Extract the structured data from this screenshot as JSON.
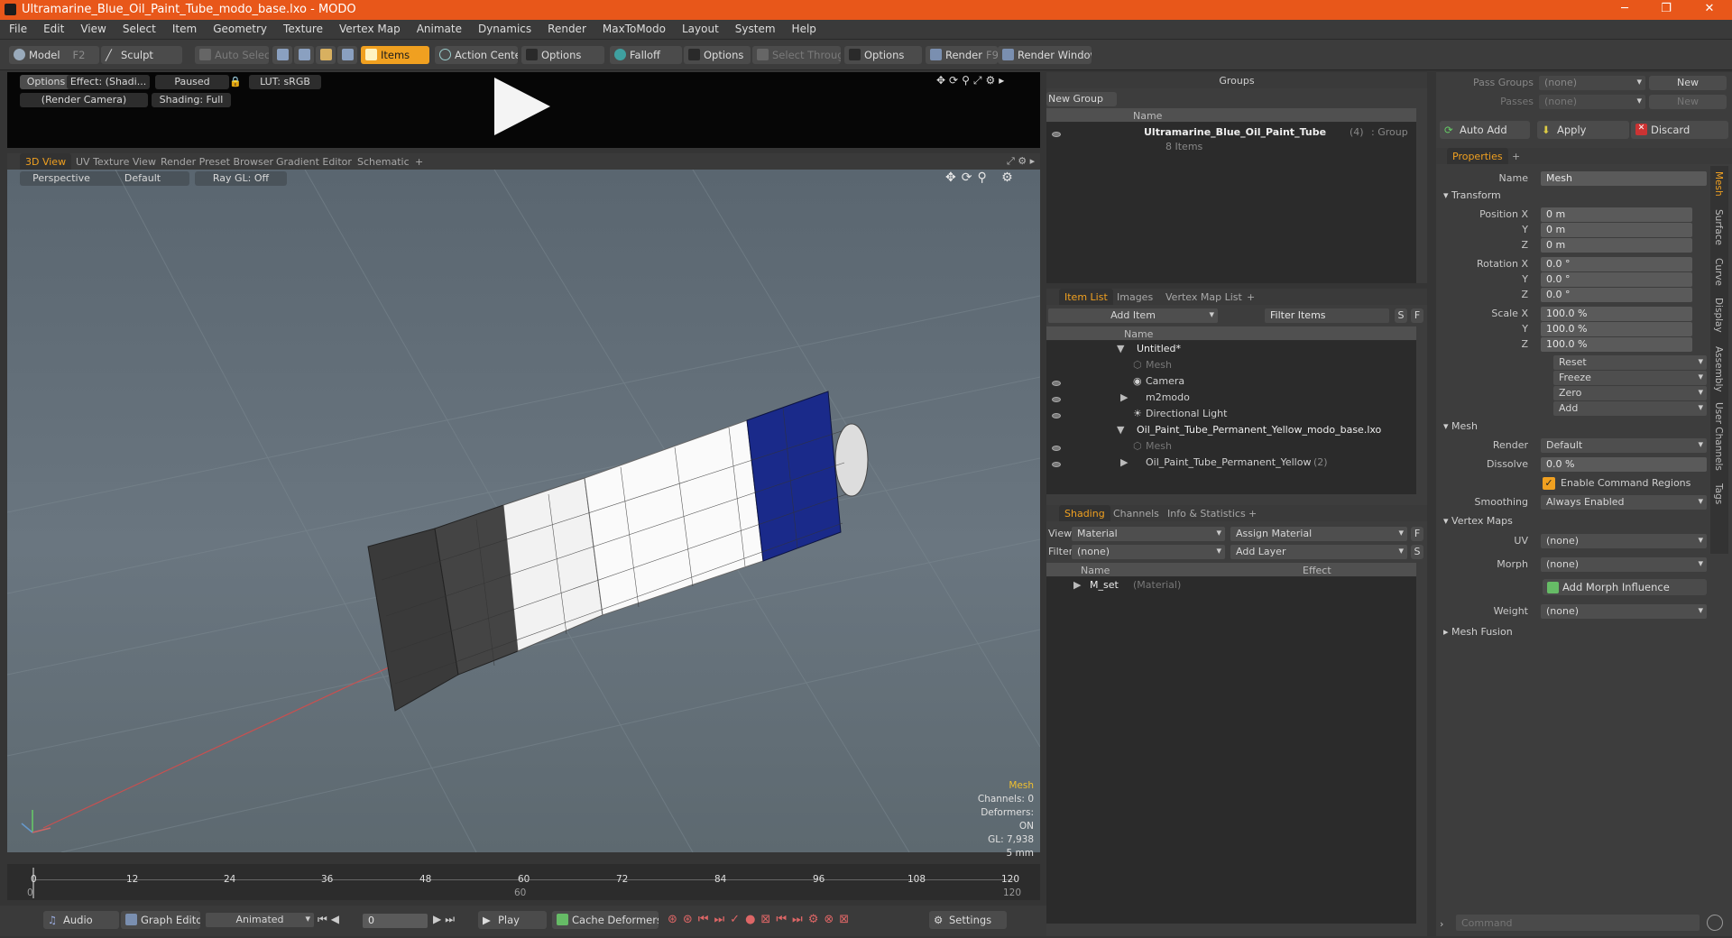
{
  "window": {
    "title": "Ultramarine_Blue_Oil_Paint_Tube_modo_base.lxo - MODO",
    "controls": [
      "─",
      "❐",
      "✕"
    ]
  },
  "menu": [
    "File",
    "Edit",
    "View",
    "Select",
    "Item",
    "Geometry",
    "Texture",
    "Vertex Map",
    "Animate",
    "Dynamics",
    "Render",
    "MaxToModo",
    "Layout",
    "System",
    "Help"
  ],
  "toolbar": {
    "model": "Model",
    "model_key": "F2",
    "sculpt": "Sculpt",
    "auto_select": "Auto Select",
    "items": "Items",
    "action_center": "Action Center",
    "options1": "Options",
    "falloff": "Falloff",
    "options2": "Options",
    "select_through": "Select Through",
    "options3": "Options",
    "render": "Render",
    "render_key": "F9",
    "render_window": "Render Window"
  },
  "preview": {
    "options": "Options",
    "effect": "Effect: (Shadi...",
    "paused": "Paused",
    "lut": "LUT: sRGB",
    "camera": "(Render Camera)",
    "shading": "Shading: Full"
  },
  "view_tabs": [
    "3D View",
    "UV Texture View",
    "Render Preset Browser",
    "Gradient Editor",
    "Schematic",
    "+"
  ],
  "view_bar": {
    "perspective": "Perspective",
    "default": "Default",
    "raygl": "Ray GL: Off"
  },
  "viewport_info": {
    "mesh": "Mesh",
    "channels": "Channels: 0",
    "deformers": "Deformers: ON",
    "gl": "GL: 7,938",
    "scale": "5 mm"
  },
  "timeline": {
    "ticks": [
      "0",
      "12",
      "24",
      "36",
      "48",
      "60",
      "72",
      "84",
      "96",
      "108",
      "120"
    ],
    "sub_ticks": [
      "0",
      "60",
      "120",
      "120"
    ]
  },
  "bottom_bar": {
    "audio": "Audio",
    "graph_editor": "Graph Editor",
    "animated": "Animated",
    "frame": "0",
    "play": "Play",
    "cache_deformers": "Cache Deformers",
    "settings": "Settings"
  },
  "groups": {
    "title": "Groups",
    "new_group": "New Group",
    "name_col": "Name",
    "item_name": "Ultramarine_Blue_Oil_Paint_Tube",
    "item_count": "(4)",
    "item_type": ": Group",
    "item_sub": "8 Items"
  },
  "item_list": {
    "tabs": [
      "Item List",
      "Images",
      "Vertex Map List",
      "+"
    ],
    "add_item": "Add Item",
    "filter_items": "Filter Items",
    "s": "S",
    "f": "F",
    "name_col": "Name",
    "rows": [
      {
        "label": "Untitled*",
        "indent": 0,
        "type": "scene",
        "dim": false
      },
      {
        "label": "Mesh",
        "indent": 1,
        "type": "mesh",
        "dim": true
      },
      {
        "label": "Camera",
        "indent": 1,
        "type": "camera",
        "dim": false
      },
      {
        "label": "m2modo",
        "indent": 1,
        "type": "locator",
        "dim": false
      },
      {
        "label": "Directional Light",
        "indent": 1,
        "type": "light",
        "dim": false
      },
      {
        "label": "Oil_Paint_Tube_Permanent_Yellow_modo_base.lxo",
        "indent": 0,
        "type": "scene",
        "dim": false
      },
      {
        "label": "Mesh",
        "indent": 1,
        "type": "mesh",
        "dim": true
      },
      {
        "label": "Oil_Paint_Tube_Permanent_Yellow",
        "indent": 1,
        "type": "locator",
        "dim": false,
        "suffix": "(2)"
      }
    ]
  },
  "shading": {
    "tabs": [
      "Shading",
      "Channels",
      "Info & Statistics",
      "+"
    ],
    "view_label": "View",
    "view_value": "Material",
    "assign_material": "Assign Material",
    "f": "F",
    "filter_label": "Filter",
    "filter_value": "(none)",
    "add_layer": "Add Layer",
    "s": "S",
    "name_col": "Name",
    "effect_col": "Effect",
    "row_name": "M_set",
    "row_type": "(Material)"
  },
  "pass": {
    "pass_groups": "Pass Groups",
    "passes": "Passes",
    "none": "(none)",
    "new": "New"
  },
  "actions": {
    "auto_add": "Auto Add",
    "apply": "Apply",
    "discard": "Discard"
  },
  "properties": {
    "tab": "Properties",
    "plus": "+",
    "name_label": "Name",
    "name_value": "Mesh",
    "transform": "Transform",
    "position_label": "Position X",
    "y": "Y",
    "z": "Z",
    "x_only": "X",
    "pos": [
      "0 m",
      "0 m",
      "0 m"
    ],
    "rotation_label": "Rotation X",
    "rot": [
      "0.0 °",
      "0.0 °",
      "0.0 °"
    ],
    "scale_label": "Scale X",
    "scale": [
      "100.0 %",
      "100.0 %",
      "100.0 %"
    ],
    "reset": "Reset",
    "freeze": "Freeze",
    "zero": "Zero",
    "add": "Add",
    "mesh": "Mesh",
    "render_label": "Render",
    "render_value": "Default",
    "dissolve_label": "Dissolve",
    "dissolve_value": "0.0 %",
    "enable_cmd": "Enable Command Regions",
    "smoothing_label": "Smoothing",
    "smoothing_value": "Always Enabled",
    "vertex_maps": "Vertex Maps",
    "uv_label": "UV",
    "uv_value": "(none)",
    "morph_label": "Morph",
    "morph_value": "(none)",
    "add_morph": "Add Morph Influence",
    "weight_label": "Weight",
    "weight_value": "(none)",
    "mesh_fusion": "Mesh Fusion",
    "side_tabs": [
      "Mesh",
      "Surface",
      "Curve",
      "Display",
      "Assembly",
      "User Channels",
      "Tags"
    ]
  },
  "command": {
    "placeholder": "Command"
  },
  "colors": {
    "accent": "#f0a020",
    "title": "#e8571a",
    "tube_blue": "#1a2a8a"
  }
}
